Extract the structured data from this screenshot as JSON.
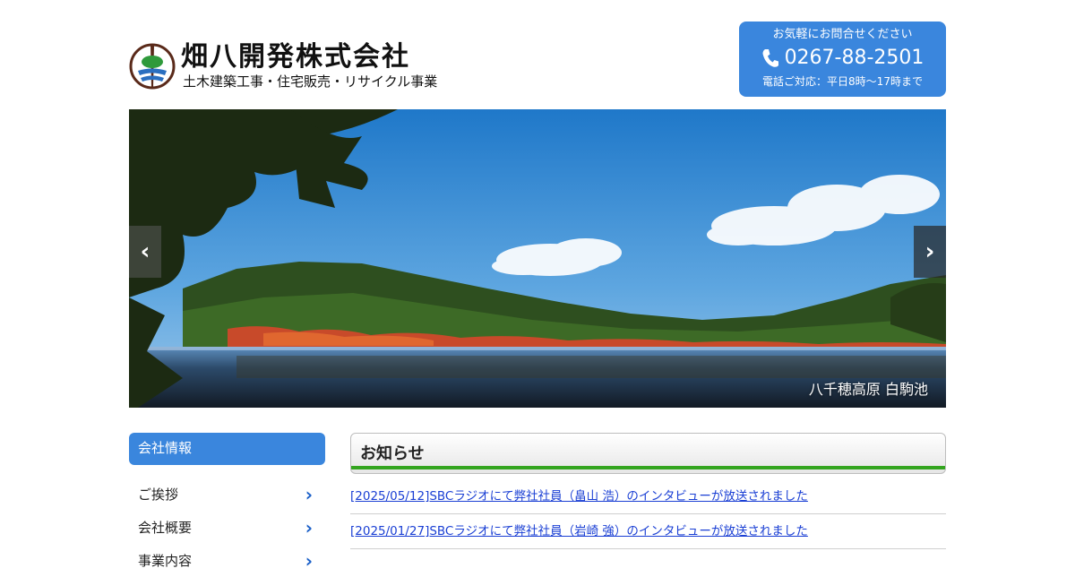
{
  "header": {
    "company_name": "畑八開発株式会社",
    "tagline": "土木建築工事・住宅販売・リサイクル事業",
    "contact": {
      "lead": "お気軽にお問合せください",
      "phone": "0267-88-2501",
      "hours": "電話ご対応：平日8時〜17時まで"
    }
  },
  "hero": {
    "caption": "八千穂高原 白駒池",
    "prev_label": "‹",
    "next_label": "›"
  },
  "sidebar": {
    "heading": "会社情報",
    "items": [
      {
        "label": "ご挨拶",
        "chevron": "›"
      },
      {
        "label": "会社概要",
        "chevron": "›"
      },
      {
        "label": "事業内容",
        "chevron": "›"
      }
    ]
  },
  "news": {
    "heading": "お知らせ",
    "items": [
      {
        "text": "[2025/05/12]SBCラジオにて弊社社員（畠山 浩）のインタビューが放送されました"
      },
      {
        "text": "[2025/01/27]SBCラジオにて弊社社員（岩崎 強）のインタビューが放送されました"
      }
    ]
  },
  "colors": {
    "accent_blue": "#3a86dd",
    "news_rule_green": "#33a51f",
    "link_blue": "#1a3fd4"
  },
  "icons": [
    "logo-mark-icon",
    "phone-icon",
    "chevron-right-icon",
    "chevron-left-icon"
  ]
}
